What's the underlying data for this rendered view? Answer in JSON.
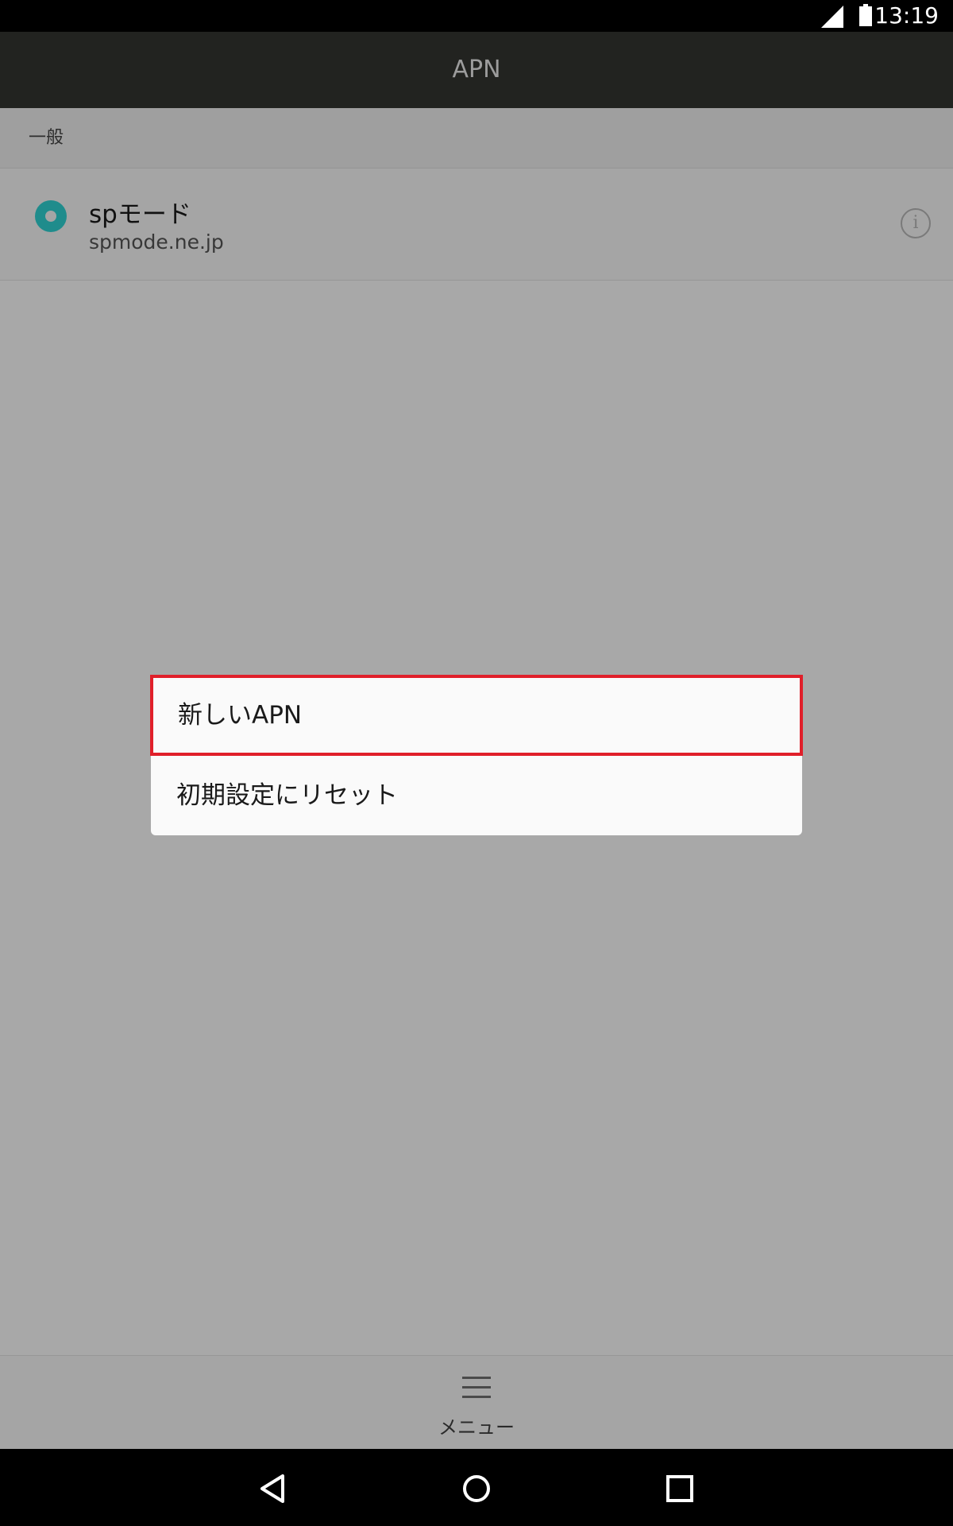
{
  "status_bar": {
    "time": "13:19",
    "icons": [
      "signal-icon",
      "battery-icon"
    ]
  },
  "app_bar": {
    "title": "APN"
  },
  "section": {
    "label": "一般"
  },
  "apn_list": [
    {
      "name": "spモード",
      "apn": "spmode.ne.jp",
      "selected": true
    }
  ],
  "menu_popup": {
    "items": [
      {
        "label": "新しいAPN",
        "highlighted": true
      },
      {
        "label": "初期設定にリセット",
        "highlighted": false
      }
    ],
    "highlight_color": "#e01f2a"
  },
  "bottom_bar": {
    "menu_label": "メニュー"
  },
  "nav_bar": {
    "buttons": [
      "back-icon",
      "home-icon",
      "recents-icon"
    ]
  },
  "colors": {
    "accent": "#1f8c8c",
    "status_bar": "#000000",
    "app_bar": "#222320"
  }
}
